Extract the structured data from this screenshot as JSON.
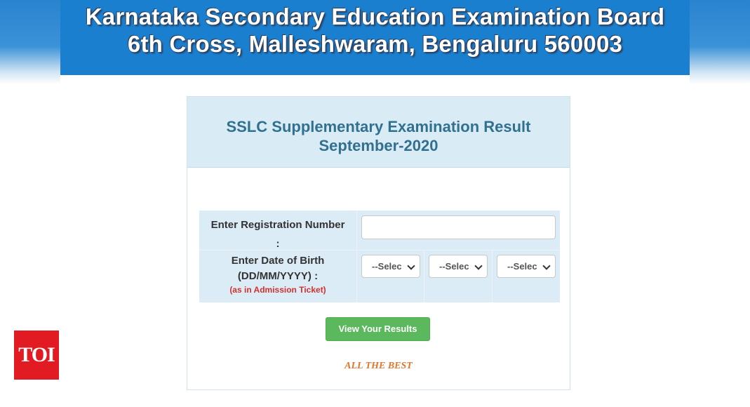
{
  "header": {
    "line1": "Karnataka Secondary Education Examination Board",
    "line2": "6th Cross, Malleshwaram, Bengaluru 560003"
  },
  "card": {
    "title_line1": "SSLC Supplementary Examination Result",
    "title_line2": "September-2020"
  },
  "form": {
    "registration_label_line1": "Enter Registration Number",
    "registration_label_line2": ":",
    "registration_value": "",
    "dob_label_line1": "Enter Date of Birth",
    "dob_label_line2": "(DD/MM/YYYY) :",
    "dob_note": "(as in Admission Ticket)",
    "day_select": "--Select--",
    "month_select": "--Select--",
    "year_select": "--Select--",
    "submit_label": "View Your Results"
  },
  "footer_text": "ALL THE BEST",
  "watermark": "TOI",
  "colors": {
    "header_bg": "#1b7fcf",
    "card_head_bg": "#d9ecf6",
    "title_text": "#31708f",
    "button_bg": "#5cb85c",
    "note_red": "#d0312d",
    "best_orange": "#e0772c",
    "toi_red": "#e21b22"
  }
}
